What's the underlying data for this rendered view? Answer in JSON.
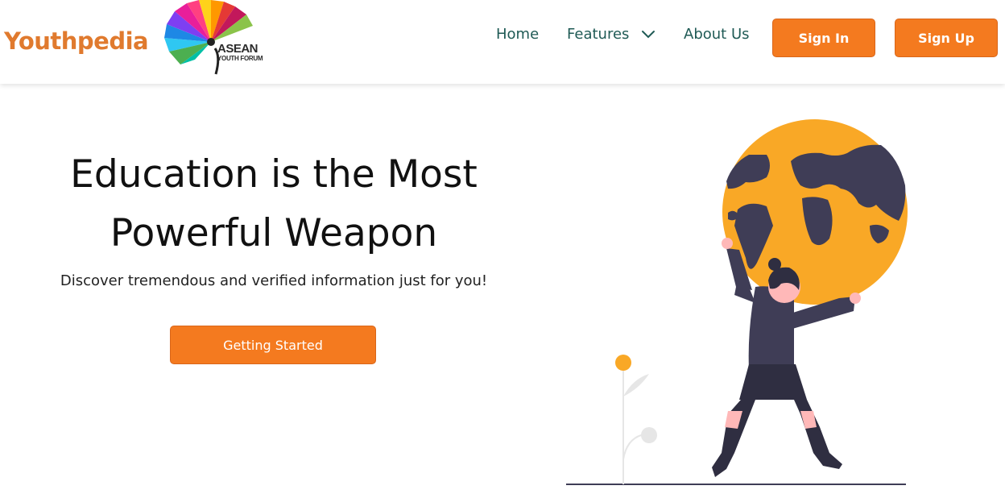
{
  "header": {
    "brand": "Youthpedia",
    "logo_line1": "ASEAN",
    "logo_line2": "YOUTH FORUM"
  },
  "nav": {
    "home": "Home",
    "features": "Features",
    "about": "About Us"
  },
  "auth": {
    "sign_in": "Sign In",
    "sign_up": "Sign Up"
  },
  "hero": {
    "title_line1": "Education is the Most",
    "title_line2": "Powerful Weapon",
    "subtitle": "Discover tremendous and verified information just for you!",
    "cta": "Getting Started"
  },
  "colors": {
    "accent": "#f47a1f",
    "brand_text": "#e07a2e",
    "nav_text": "#1f5a55",
    "globe": "#f9a826",
    "figure": "#3f3d56"
  },
  "icons": {
    "features_dropdown": "chevron-down-icon"
  }
}
